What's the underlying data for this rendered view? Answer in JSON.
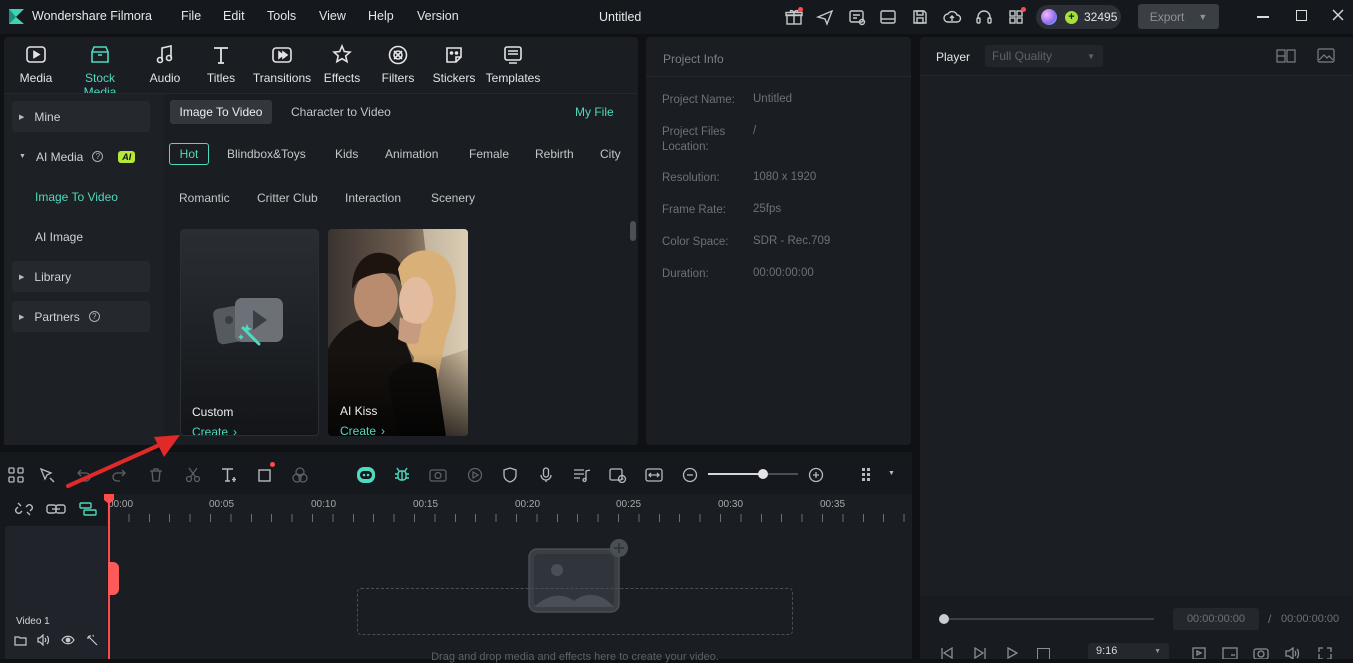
{
  "app": {
    "name": "Wondershare Filmora",
    "document_title": "Untitled"
  },
  "menu": [
    "File",
    "Edit",
    "Tools",
    "View",
    "Help",
    "Version"
  ],
  "topbar": {
    "credits": "32495",
    "export_label": "Export"
  },
  "toolbar": {
    "items": [
      {
        "label": "Media",
        "icon": "media-icon"
      },
      {
        "label": "Stock Media",
        "icon": "stock-media-icon"
      },
      {
        "label": "Audio",
        "icon": "audio-icon"
      },
      {
        "label": "Titles",
        "icon": "titles-icon"
      },
      {
        "label": "Transitions",
        "icon": "transitions-icon"
      },
      {
        "label": "Effects",
        "icon": "effects-icon"
      },
      {
        "label": "Filters",
        "icon": "filters-icon"
      },
      {
        "label": "Stickers",
        "icon": "stickers-icon"
      },
      {
        "label": "Templates",
        "icon": "templates-icon"
      }
    ],
    "active_index": 1
  },
  "sidebar": {
    "mine": "Mine",
    "ai_media": "AI Media",
    "ai_badge": "AI",
    "image_to_video": "Image To Video",
    "ai_image": "AI Image",
    "library": "Library",
    "partners": "Partners"
  },
  "content": {
    "tabs": [
      "Image To Video",
      "Character to Video"
    ],
    "my_file": "My File",
    "chips_row1": [
      "Hot",
      "Blindbox&Toys",
      "Kids",
      "Animation",
      "Female",
      "Rebirth",
      "City"
    ],
    "chips_row2": [
      "Romantic",
      "Critter Club",
      "Interaction",
      "Scenery"
    ],
    "cards": [
      {
        "title": "Custom",
        "action": "Create"
      },
      {
        "title": "AI Kiss",
        "action": "Create"
      }
    ]
  },
  "project_info": {
    "heading": "Project Info",
    "rows": [
      {
        "label": "Project Name:",
        "value": "Untitled"
      },
      {
        "label": "Project Files Location:",
        "value": "/"
      },
      {
        "label": "Resolution:",
        "value": "1080 x 1920"
      },
      {
        "label": "Frame Rate:",
        "value": "25fps"
      },
      {
        "label": "Color Space:",
        "value": "SDR - Rec.709"
      },
      {
        "label": "Duration:",
        "value": "00:00:00:00"
      }
    ]
  },
  "player": {
    "label": "Player",
    "quality": "Full Quality",
    "current_time": "00:00:00:00",
    "separator": "/",
    "total_time": "00:00:00:00",
    "aspect": "9:16"
  },
  "timeline": {
    "ruler": [
      "00:00",
      "00:05",
      "00:10",
      "00:15",
      "00:20",
      "00:25",
      "00:30",
      "00:35"
    ],
    "track_name": "Video 1",
    "drop_hint": "Drag and drop media and effects here to create your video."
  },
  "colors": {
    "accent": "#4fd9bf",
    "playhead": "#ff4b4b",
    "annotation_arrow": "#e02a2a"
  }
}
